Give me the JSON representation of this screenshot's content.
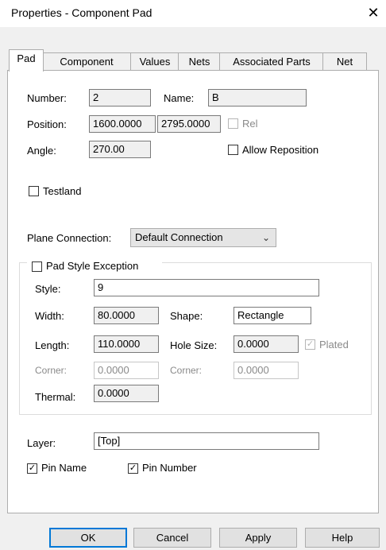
{
  "window": {
    "title": "Properties - Component Pad",
    "close_glyph": "✕"
  },
  "tabs": [
    {
      "label": "Pad",
      "active": true
    },
    {
      "label": "Component",
      "active": false
    },
    {
      "label": "Values",
      "active": false
    },
    {
      "label": "Nets",
      "active": false
    },
    {
      "label": "Associated Parts",
      "active": false
    },
    {
      "label": "Net",
      "active": false
    }
  ],
  "pad": {
    "number_label": "Number:",
    "number_value": "2",
    "name_label": "Name:",
    "name_value": "B",
    "position_label": "Position:",
    "position_x": "1600.0000",
    "position_y": "2795.0000",
    "rel_label": "Rel",
    "rel_checked": false,
    "angle_label": "Angle:",
    "angle_value": "270.00",
    "allow_reposition_label": "Allow Reposition",
    "allow_reposition_checked": false,
    "testland_label": "Testland",
    "testland_checked": false,
    "plane_connection_label": "Plane Connection:",
    "plane_connection_value": "Default Connection",
    "pad_style_exception_label": "Pad Style Exception",
    "pad_style_exception_checked": false,
    "style_label": "Style:",
    "style_value": "9",
    "width_label": "Width:",
    "width_value": "80.0000",
    "shape_label": "Shape:",
    "shape_value": "Rectangle",
    "length_label": "Length:",
    "length_value": "110.0000",
    "hole_size_label": "Hole Size:",
    "hole_size_value": "0.0000",
    "plated_label": "Plated",
    "plated_checked": true,
    "corner_label_1": "Corner:",
    "corner_value_1": "0.0000",
    "corner_label_2": "Corner:",
    "corner_value_2": "0.0000",
    "thermal_label": "Thermal:",
    "thermal_value": "0.0000",
    "layer_label": "Layer:",
    "layer_value": "[Top]",
    "pin_name_label": "Pin Name",
    "pin_name_checked": true,
    "pin_number_label": "Pin Number",
    "pin_number_checked": true
  },
  "buttons": {
    "ok": "OK",
    "cancel": "Cancel",
    "apply": "Apply",
    "help": "Help"
  },
  "icons": {
    "close": "close-icon",
    "dropdown": "chevron-down-icon",
    "check": "checkmark-icon"
  },
  "colors": {
    "default_button_border": "#0078d7",
    "client_bg": "#f0f0f0",
    "disabled_text": "#8a8a8a"
  }
}
